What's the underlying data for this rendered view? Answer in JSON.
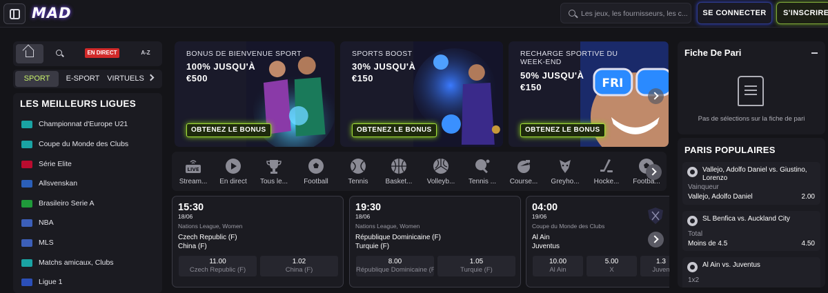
{
  "header": {
    "logo": "MAD",
    "search_placeholder": "Les jeux, les fournisseurs, les c...",
    "login_label": "SE CONNECTER",
    "signup_label": "S'INSCRIRE"
  },
  "nav": {
    "live_label": "EN DIRECT",
    "az_label": "A-Z",
    "tabs": [
      "SPORT",
      "E-SPORT",
      "VIRTUELS"
    ]
  },
  "leagues": {
    "title": "LES MEILLEURS LIGUES",
    "items": [
      {
        "label": "Championnat d'Europe U21",
        "flag": "#1aa3a3"
      },
      {
        "label": "Coupe du Monde des Clubs",
        "flag": "#1aa3a3"
      },
      {
        "label": "Série Elite",
        "flag": "#ba0c2f"
      },
      {
        "label": "Allsvenskan",
        "flag": "#2b5fb8"
      },
      {
        "label": "Brasileiro Serie A",
        "flag": "#1f9a3a"
      },
      {
        "label": "NBA",
        "flag": "#3c5fb8"
      },
      {
        "label": "MLS",
        "flag": "#3c5fb8"
      },
      {
        "label": "Matchs amicaux, Clubs",
        "flag": "#1aa3a3"
      },
      {
        "label": "Ligue 1",
        "flag": "#2b4fb8"
      }
    ]
  },
  "banners": [
    {
      "subtitle": "BONUS DE BIENVENUE SPORT",
      "headline": "100% JUSQU'À €500",
      "cta": "OBTENEZ LE BONUS"
    },
    {
      "subtitle": "SPORTS BOOST",
      "headline": "30% JUSQU'À €150",
      "cta": "OBTENEZ LE BONUS"
    },
    {
      "subtitle": "RECHARGE SPORTIVE DU WEEK-END",
      "headline": "50% JUSQU'À €150",
      "cta": "OBTENEZ LE BONUS"
    }
  ],
  "banner_art_text": "FRI",
  "sports": [
    "Stream...",
    "En direct",
    "Tous le...",
    "Football",
    "Tennis",
    "Basket...",
    "Volleyb...",
    "Tennis ...",
    "Course...",
    "Greyho...",
    "Hocke...",
    "Footba..."
  ],
  "live_icon_text": "LIVE",
  "matches": [
    {
      "time": "15:30",
      "date": "18/06",
      "competition": "Nations League, Women",
      "team1": "Czech Republic (F)",
      "team2": "China (F)",
      "odds": [
        {
          "value": "11.00",
          "name": "Czech Republic (F)"
        },
        {
          "value": "1.02",
          "name": "China (F)"
        }
      ]
    },
    {
      "time": "19:30",
      "date": "18/06",
      "competition": "Nations League, Women",
      "team1": "République Dominicaine (F)",
      "team2": "Turquie (F)",
      "odds": [
        {
          "value": "8.00",
          "name": "République Dominicaine (F)"
        },
        {
          "value": "1.05",
          "name": "Turquie (F)"
        }
      ]
    },
    {
      "time": "04:00",
      "date": "19/06",
      "competition": "Coupe du Monde des Clubs",
      "team1": "Al Ain",
      "team2": "Juventus",
      "odds": [
        {
          "value": "10.00",
          "name": "Al Ain"
        },
        {
          "value": "5.00",
          "name": "X"
        },
        {
          "value": "1.3",
          "name": "Juven"
        }
      ]
    }
  ],
  "betslip": {
    "title": "Fiche De Pari",
    "empty_text": "Pas de sélections sur la fiche de pari"
  },
  "popular": {
    "title": "PARIS POPULAIRES",
    "items": [
      {
        "teams": "Vallejo, Adolfo Daniel vs. Giustino, Lorenzo",
        "market": "Vainqueur",
        "selection": "Vallejo, Adolfo Daniel",
        "odd": "2.00"
      },
      {
        "teams": "SL Benfica vs. Auckland City",
        "market": "Total",
        "selection": "Moins de 4.5",
        "odd": "4.50"
      },
      {
        "teams": "Al Ain vs. Juventus",
        "market": "1x2",
        "selection": "",
        "odd": ""
      }
    ]
  },
  "colors": {
    "accent_green": "#a6e23a",
    "live_red": "#d22a2a",
    "background": "#141418"
  }
}
